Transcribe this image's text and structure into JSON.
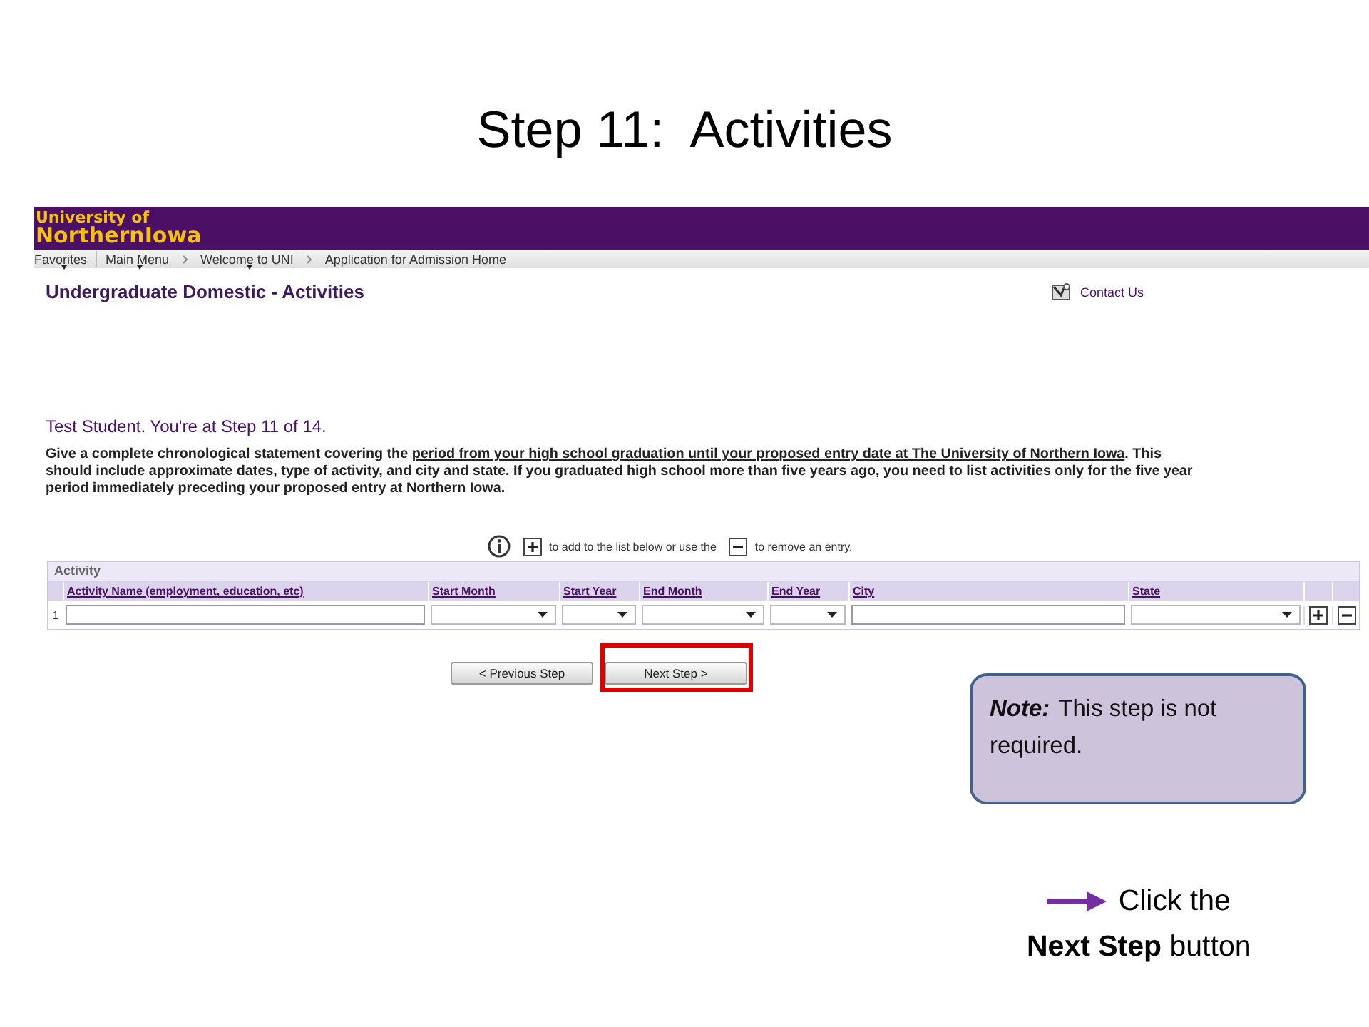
{
  "slide_title": "Step 11:  Activities",
  "header": {
    "logo_lines": [
      "University of",
      "NorthernIowa"
    ]
  },
  "nav": [
    {
      "label": "Favorites",
      "menu": true
    },
    {
      "label": "Main Menu",
      "menu": true
    },
    {
      "label": "Welcome to UNI",
      "menu": true
    },
    {
      "label": "Application for Admission Home",
      "menu": false
    }
  ],
  "page_heading": "Undergraduate Domestic - Activities",
  "contact_link": "Contact Us",
  "step_text": "Test Student. You're at Step 11 of 14.",
  "instructions": {
    "before": "Give a complete chronological statement covering the ",
    "link": "period from your high school graduation until your proposed entry date at The University of Northern Iowa",
    "after": ". This should include approximate dates, type of activity, and city and state. If you graduated high school more than five years ago, you need to list activities only for the five year period immediately preceding your proposed entry at Northern Iowa."
  },
  "hint": {
    "add_text": "to add to the list below or use the",
    "remove_text": "to remove an entry."
  },
  "table": {
    "title": "Activity",
    "columns": [
      {
        "label": "Activity Name (employment, education, etc)",
        "kind": "text"
      },
      {
        "label": "Start Month",
        "kind": "select"
      },
      {
        "label": "Start Year",
        "kind": "select"
      },
      {
        "label": "End Month",
        "kind": "select"
      },
      {
        "label": "End Year",
        "kind": "select"
      },
      {
        "label": "City",
        "kind": "text"
      },
      {
        "label": "State",
        "kind": "select"
      }
    ],
    "rows": [
      {
        "number": "1"
      }
    ]
  },
  "buttons": [
    {
      "label": "< Previous Step",
      "highlighted": false
    },
    {
      "label": "Next Step >",
      "highlighted": true
    }
  ],
  "note": {
    "label": "Note:",
    "text": "This step is not required."
  },
  "callout": {
    "lines": [
      "Click the",
      "**Next Step** button"
    ]
  }
}
